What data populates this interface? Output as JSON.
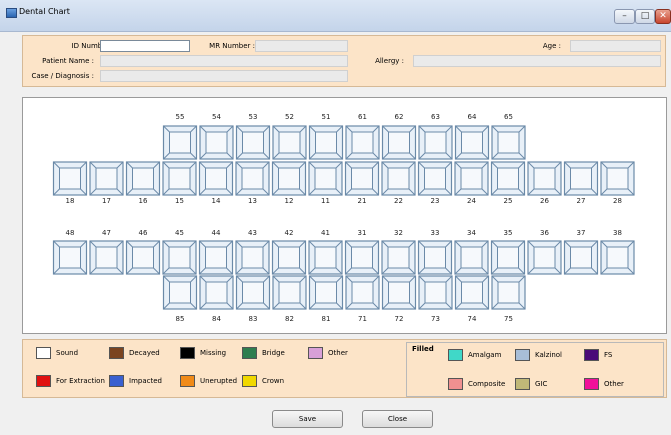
{
  "window": {
    "title": "Dental Chart",
    "min_glyph": "–",
    "max_glyph": "□",
    "close_glyph": "✕"
  },
  "form": {
    "id_number": {
      "label": "ID Number :",
      "value": ""
    },
    "mr_number": {
      "label": "MR Number :",
      "value": ""
    },
    "age": {
      "label": "Age :",
      "value": ""
    },
    "patient_name": {
      "label": "Patient Name :",
      "value": ""
    },
    "allergy": {
      "label": "Allergy :",
      "value": ""
    },
    "case_diagnosis": {
      "label": "Case / Diagnosis :",
      "value": ""
    }
  },
  "chart": {
    "upper_primary": [
      "55",
      "54",
      "53",
      "52",
      "51",
      "61",
      "62",
      "63",
      "64",
      "65"
    ],
    "upper_permanent": [
      "18",
      "17",
      "16",
      "15",
      "14",
      "13",
      "12",
      "11",
      "21",
      "22",
      "23",
      "24",
      "25",
      "26",
      "27",
      "28"
    ],
    "lower_permanent": [
      "48",
      "47",
      "46",
      "45",
      "44",
      "43",
      "42",
      "41",
      "31",
      "32",
      "33",
      "34",
      "35",
      "36",
      "37",
      "38"
    ],
    "lower_primary": [
      "85",
      "84",
      "83",
      "82",
      "81",
      "71",
      "72",
      "73",
      "74",
      "75"
    ]
  },
  "legend": {
    "conditions": [
      {
        "label": "Sound",
        "color": "#ffffff"
      },
      {
        "label": "Decayed",
        "color": "#7b4420"
      },
      {
        "label": "Missing",
        "color": "#000000"
      },
      {
        "label": "Bridge",
        "color": "#2e7d4f"
      },
      {
        "label": "Other",
        "color": "#d8a0d8"
      },
      {
        "label": "For Extraction",
        "color": "#e01010"
      },
      {
        "label": "Impacted",
        "color": "#3a60d0"
      },
      {
        "label": "Unerupted",
        "color": "#f08a18"
      },
      {
        "label": "Crown",
        "color": "#f0d800"
      }
    ],
    "filled_title": "Filled",
    "filled": [
      {
        "label": "Amalgam",
        "color": "#40d8c8"
      },
      {
        "label": "Kalzinol",
        "color": "#a8bed8"
      },
      {
        "label": "FS",
        "color": "#4a0a78"
      },
      {
        "label": "Composite",
        "color": "#f09090"
      },
      {
        "label": "GIC",
        "color": "#c0b878"
      },
      {
        "label": "Other",
        "color": "#f0109a"
      }
    ]
  },
  "buttons": {
    "save": "Save",
    "close": "Close"
  }
}
